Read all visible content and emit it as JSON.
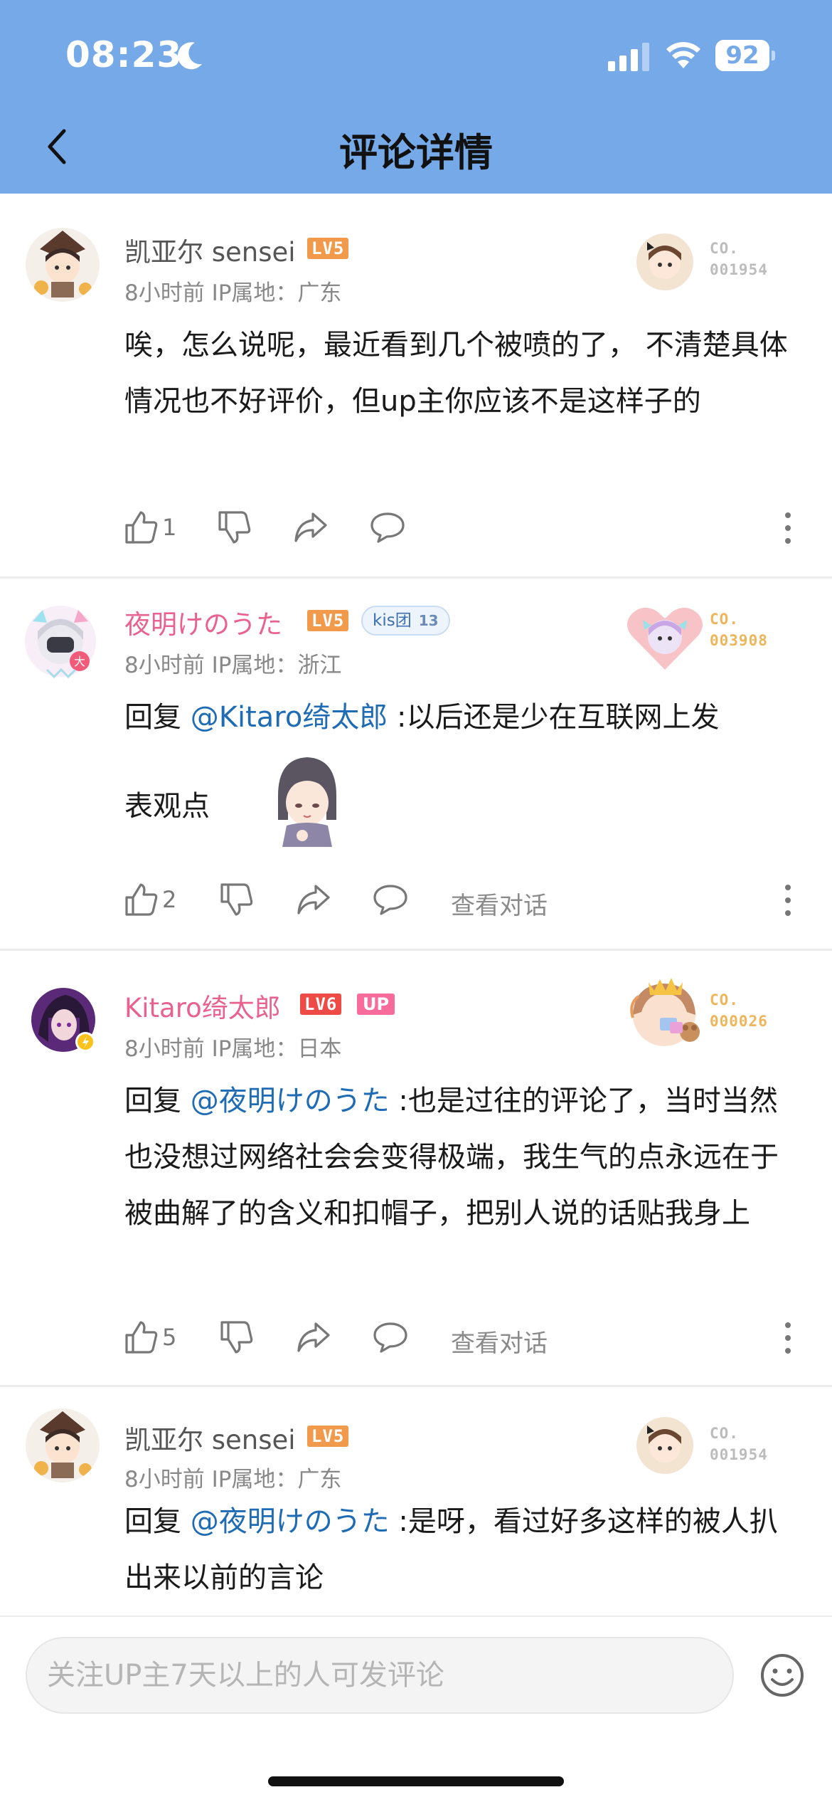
{
  "status_bar": {
    "time": "08:23",
    "battery": "92"
  },
  "header": {
    "title": "评论详情"
  },
  "comments": [
    {
      "username": "凯亚尔 sensei",
      "level": "LV5",
      "time": "8小时前",
      "ip": "IP属地：广东",
      "deco_no": [
        "CO.",
        "001954"
      ],
      "text": "唉，怎么说呢，最近看到几个被喷的了， 不清楚具体情况也不好评价，但up主你应该不是这样子的",
      "likes": "1"
    },
    {
      "username": "夜明けのうた",
      "level": "LV5",
      "fan_badge": {
        "name": "kis团",
        "level": "13"
      },
      "time": "8小时前",
      "ip": "IP属地：浙江",
      "deco_no": [
        "CO.",
        "003908"
      ],
      "reply_prefix": "回复 ",
      "mention": "@Kitaro绮太郎",
      "text_line1": " :以后还是少在互联网上发",
      "text_line2": "表观点",
      "likes": "2",
      "view_conversation": "查看对话"
    },
    {
      "username": "Kitaro绮太郎",
      "level": "LV6",
      "up_badge": "UP",
      "time": "8小时前",
      "ip": "IP属地：日本",
      "deco_no": [
        "CO.",
        "000026"
      ],
      "reply_prefix": "回复 ",
      "mention": "@夜明けのうた",
      "text": " :也是过往的评论了，当时当然也没想过网络社会会变得极端，我生气的点永远在于被曲解了的含义和扣帽子，把别人说的话贴我身上",
      "likes": "5",
      "view_conversation": "查看对话"
    },
    {
      "username": "凯亚尔 sensei",
      "level": "LV5",
      "time": "8小时前",
      "ip": "IP属地：广东",
      "deco_no": [
        "CO.",
        "001954"
      ],
      "reply_prefix": "回复 ",
      "mention": "@夜明けのうた",
      "text": " :是呀，看过好多这样的被人扒出来以前的言论"
    }
  ],
  "input": {
    "placeholder": "关注UP主7天以上的人可发评论"
  },
  "colors": {
    "header_bg": "#76a9e8",
    "mention": "#1f6cb4",
    "vip_name": "#e9628d",
    "lv5": "#f29a4c",
    "lv6": "#ef4b46"
  }
}
